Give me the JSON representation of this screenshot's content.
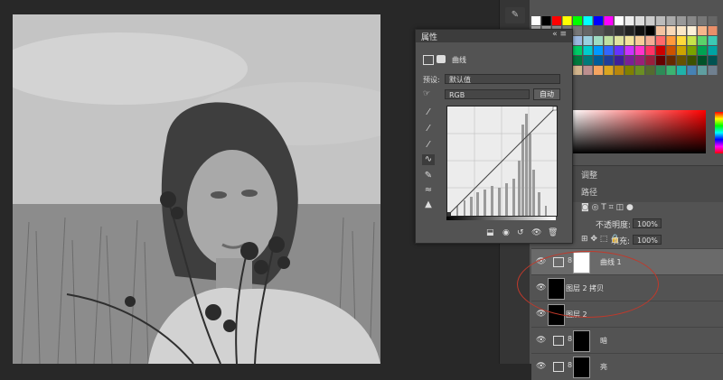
{
  "properties": {
    "title": "属性",
    "panel_name": "曲线",
    "preset_label": "预设:",
    "preset_value": "默认值",
    "channel_value": "RGB",
    "auto_label": "自动"
  },
  "dock": {
    "tabs": [
      "调整",
      "路径"
    ],
    "opacity_label": "不透明度:",
    "opacity_value": "100%",
    "fill_label": "填充:",
    "fill_value": "100%"
  },
  "layers": [
    {
      "name": "曲线 1",
      "type": "curves",
      "active": true
    },
    {
      "name": "图层 2 拷贝",
      "type": "pixel",
      "active": false
    },
    {
      "name": "图层 2",
      "type": "pixel",
      "active": false
    },
    {
      "name": "暗",
      "type": "curves",
      "active": false
    },
    {
      "name": "亮",
      "type": "curves",
      "active": false
    }
  ],
  "colors": {
    "annotation": "#c0392b",
    "panel_bg": "#535353",
    "app_bg": "#282828"
  }
}
